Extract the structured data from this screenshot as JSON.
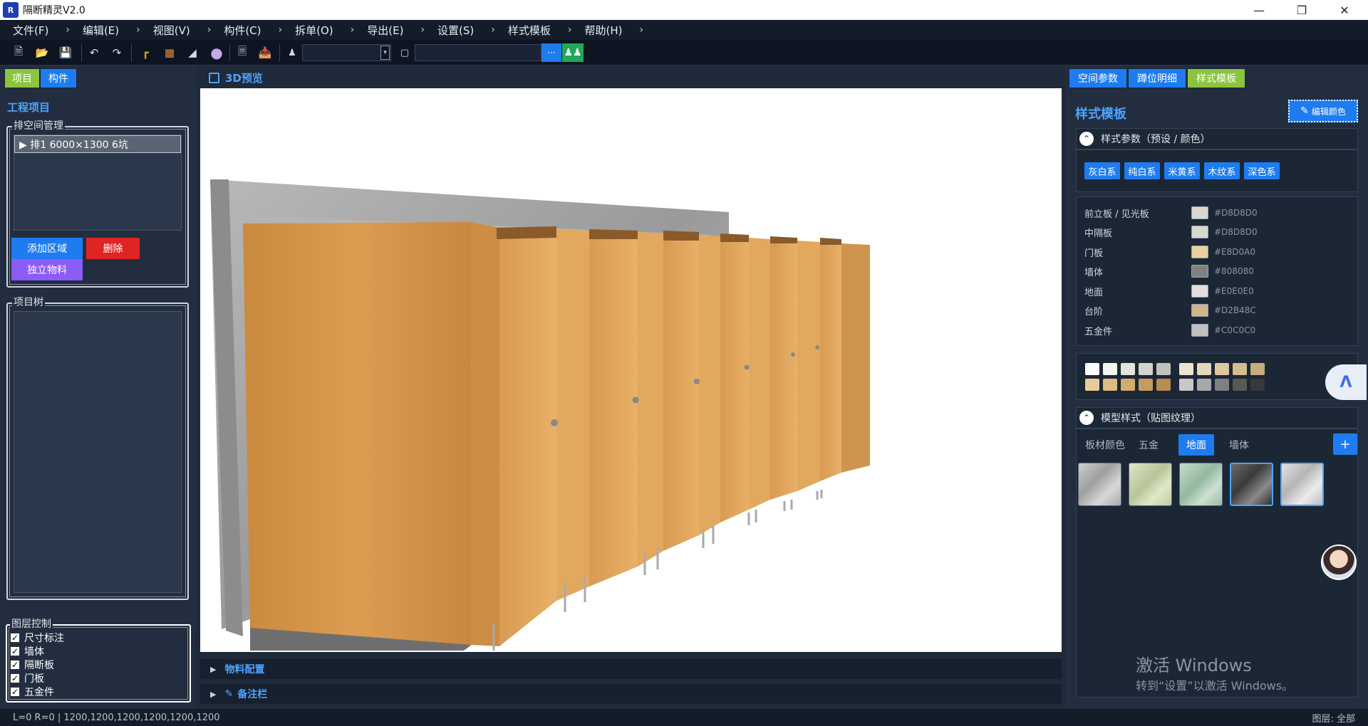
{
  "app": {
    "title": "隔断精灵V2.0",
    "logo_text": "R"
  },
  "menu": [
    "文件(F)",
    "编辑(E)",
    "视图(V)",
    "构件(C)",
    "拆单(O)",
    "导出(E)",
    "设置(S)",
    "样式模板",
    "帮助(H)"
  ],
  "toolbar": {
    "user_value": "",
    "project_value": "",
    "more_label": "···"
  },
  "left": {
    "tabs": [
      "项目",
      "构件"
    ],
    "section_title": "工程项目",
    "row_group_title": "排空间管理",
    "row_item": "▶ 排1  6000×1300 6坑",
    "add_area": "添加区域",
    "delete": "删除",
    "standalone": "独立物料",
    "tree_title": "项目树",
    "layers_title": "图层控制",
    "layers": [
      "尺寸标注",
      "墙体",
      "隔断板",
      "门板",
      "五金件"
    ]
  },
  "center": {
    "preview_title": "3D预览",
    "material_config": "物料配置",
    "notes": "备注栏"
  },
  "right": {
    "tabs": [
      "空间参数",
      "蹲位明细",
      "样式模板"
    ],
    "title": "样式模板",
    "edit_color": "编辑颜色",
    "style_params": "样式参数（预设 / 颜色）",
    "presets": [
      "灰白系",
      "纯白系",
      "米黄系",
      "木纹系",
      "深色系"
    ],
    "colors": [
      {
        "name": "前立板 / 见光板",
        "hex": "#D8D8D0"
      },
      {
        "name": "中隔板",
        "hex": "#D8D8D0"
      },
      {
        "name": "门板",
        "hex": "#E8D0A0"
      },
      {
        "name": "墙体",
        "hex": "#808080"
      },
      {
        "name": "地面",
        "hex": "#E0E0E0"
      },
      {
        "name": "台阶",
        "hex": "#D2B48C"
      },
      {
        "name": "五金件",
        "hex": "#C0C0C0"
      }
    ],
    "model_style": "模型样式（贴图纹理）",
    "model_tabs": [
      "板材颜色",
      "五金",
      "地面",
      "墙体"
    ],
    "add_label": "+"
  },
  "watermark": {
    "line1": "激活 Windows",
    "line2": "转到“设置”以激活 Windows。"
  },
  "status": {
    "left": "L=0 R=0 | 1200,1200,1200,1200,1200,1200",
    "right": "图层: 全部"
  },
  "colors": {
    "accent": "#1e7cf0",
    "tab_green": "#8bc53f",
    "danger": "#e02424",
    "purple": "#8b5cf6"
  }
}
